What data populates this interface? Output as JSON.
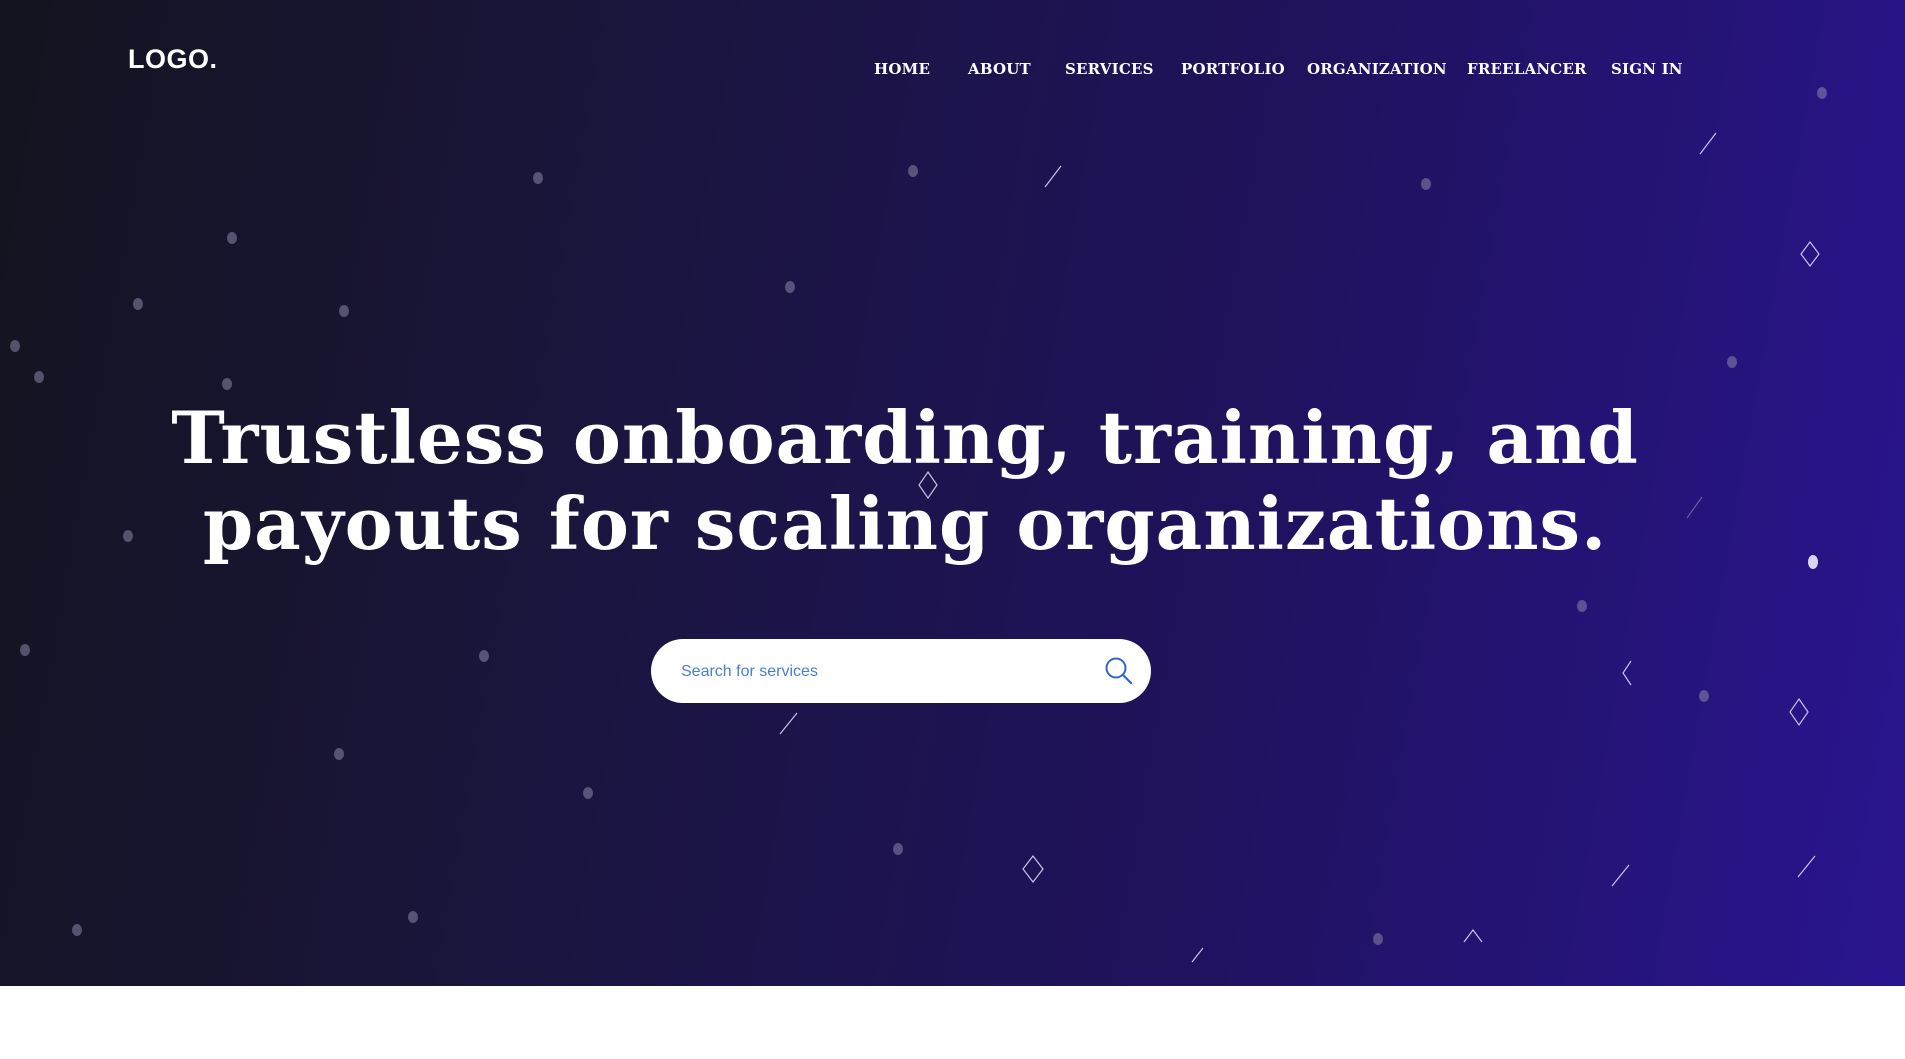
{
  "brand": {
    "logo_text": "LOGO."
  },
  "nav": {
    "items": [
      {
        "label": "HOME",
        "name": "nav-home"
      },
      {
        "label": "ABOUT",
        "name": "nav-about"
      },
      {
        "label": "SERVICES",
        "name": "nav-services"
      },
      {
        "label": "PORTFOLIO",
        "name": "nav-portfolio"
      },
      {
        "label": "ORGANIZATION",
        "name": "nav-organization"
      },
      {
        "label": "FREELANCER",
        "name": "nav-freelancer"
      },
      {
        "label": "SIGN IN",
        "name": "nav-sign-in"
      }
    ]
  },
  "hero": {
    "headline_line1": "Trustless onboarding, training, and",
    "headline_line2": "payouts for scaling organizations."
  },
  "search": {
    "placeholder": "Search for services",
    "icon": "search-icon"
  },
  "colors": {
    "hero_gradient_start": "#14141f",
    "hero_gradient_end": "#2a1590",
    "accent_blue": "#3b6fd0"
  }
}
